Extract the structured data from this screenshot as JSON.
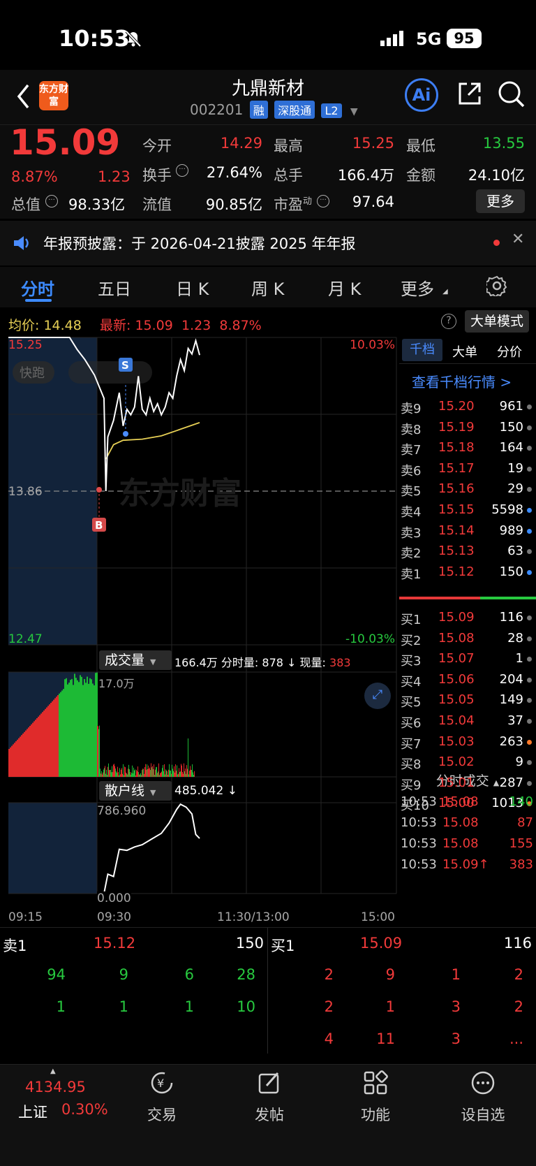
{
  "status_bar": {
    "time": "10:53",
    "network": "5G",
    "battery": "95"
  },
  "header": {
    "title": "九鼎新材",
    "code": "002201",
    "tags": [
      "融",
      "深股通",
      "L2"
    ],
    "logo_text": "东方财富",
    "ai_label": "Ai"
  },
  "quote": {
    "price": "15.09",
    "change_pct": "8.87%",
    "change": "1.23",
    "open_label": "今开",
    "open": "14.29",
    "high_label": "最高",
    "high": "15.25",
    "low_label": "最低",
    "low": "13.55",
    "turnover_label": "换手",
    "turnover": "27.64%",
    "volume_label": "总手",
    "volume": "166.4万",
    "amount_label": "金额",
    "amount": "24.10亿",
    "mktcap_label": "总值",
    "mktcap": "98.33亿",
    "float_label": "流值",
    "float": "90.85亿",
    "pe_label": "市盈",
    "pe_sup": "动",
    "pe": "97.64",
    "more_button": "更多"
  },
  "notice": {
    "text": "年报预披露：于 2026-04-21披露 2025 年年报"
  },
  "tabs": [
    "分时",
    "五日",
    "日 K",
    "周 K",
    "月 K",
    "更多"
  ],
  "active_tab": "分时",
  "chart_info": {
    "avg_label": "均价:",
    "avg": "14.48",
    "latest_label": "最新:",
    "latest": "15.09",
    "latest_change": "1.23",
    "latest_pct": "8.87%",
    "big_order_mode": "大单模式"
  },
  "chart_data": {
    "type": "line",
    "y_axis_left": {
      "top": "15.25",
      "mid": "13.86",
      "bottom": "12.47"
    },
    "y_axis_right": {
      "top": "10.03%",
      "bottom": "-10.03%"
    },
    "price_range": [
      12.47,
      15.25
    ],
    "x_ticks": [
      "09:15",
      "09:30",
      "11:30/13:00",
      "15:00"
    ],
    "watermark": "东方财富",
    "quickrun_label": "快跑",
    "markers": {
      "sell": "S",
      "buy": "B"
    },
    "price_series": [
      [
        0,
        15.25
      ],
      [
        0.32,
        15.25
      ],
      [
        0.36,
        15.14
      ],
      [
        0.4,
        15.05
      ],
      [
        0.45,
        14.91
      ],
      [
        0.5,
        14.7
      ],
      [
        0.51,
        13.86
      ],
      [
        0.52,
        14.35
      ],
      [
        0.55,
        14.5
      ],
      [
        0.58,
        14.75
      ],
      [
        0.6,
        14.45
      ],
      [
        0.62,
        14.6
      ],
      [
        0.64,
        14.55
      ],
      [
        0.66,
        14.62
      ],
      [
        0.68,
        14.9
      ],
      [
        0.7,
        14.6
      ],
      [
        0.72,
        14.55
      ],
      [
        0.74,
        14.7
      ],
      [
        0.76,
        14.58
      ],
      [
        0.78,
        14.65
      ],
      [
        0.8,
        14.55
      ],
      [
        0.82,
        14.62
      ],
      [
        0.84,
        14.75
      ],
      [
        0.86,
        14.7
      ],
      [
        0.88,
        14.9
      ],
      [
        0.9,
        15.05
      ],
      [
        0.92,
        14.95
      ],
      [
        0.94,
        15.15
      ],
      [
        0.96,
        15.1
      ],
      [
        0.98,
        15.22
      ],
      [
        1.0,
        15.09
      ]
    ],
    "avg_series": [
      [
        0.51,
        14.15
      ],
      [
        0.55,
        14.28
      ],
      [
        0.6,
        14.32
      ],
      [
        0.7,
        14.33
      ],
      [
        0.8,
        14.36
      ],
      [
        0.9,
        14.42
      ],
      [
        1.0,
        14.48
      ]
    ],
    "volume_panel": {
      "label": "成交量",
      "total": "166.4万",
      "period_label": "分时量:",
      "period": "878",
      "current_label": "现量:",
      "current": "383",
      "max": "17.0万"
    },
    "retail_panel": {
      "label": "散户线",
      "value": "485.042",
      "max": "786.960",
      "min": "0.000",
      "series": [
        [
          0.5,
          0.0
        ],
        [
          0.52,
          170
        ],
        [
          0.55,
          150
        ],
        [
          0.58,
          390
        ],
        [
          0.62,
          380
        ],
        [
          0.66,
          410
        ],
        [
          0.7,
          430
        ],
        [
          0.75,
          480
        ],
        [
          0.8,
          530
        ],
        [
          0.84,
          620
        ],
        [
          0.88,
          740
        ],
        [
          0.9,
          786
        ],
        [
          0.93,
          760
        ],
        [
          0.96,
          700
        ],
        [
          0.98,
          520
        ],
        [
          1.0,
          485
        ]
      ]
    }
  },
  "orderbook": {
    "tabs": [
      "千档",
      "大单",
      "分价"
    ],
    "link": "查看千档行情 >",
    "asks": [
      {
        "label": "卖9",
        "price": "15.20",
        "vol": "961",
        "dot": "#777"
      },
      {
        "label": "卖8",
        "price": "15.19",
        "vol": "150",
        "dot": "#777"
      },
      {
        "label": "卖7",
        "price": "15.18",
        "vol": "164",
        "dot": "#777"
      },
      {
        "label": "卖6",
        "price": "15.17",
        "vol": "19",
        "dot": "#777"
      },
      {
        "label": "卖5",
        "price": "15.16",
        "vol": "29",
        "dot": "#777"
      },
      {
        "label": "卖4",
        "price": "15.15",
        "vol": "5598",
        "dot": "#3c8cff"
      },
      {
        "label": "卖3",
        "price": "15.14",
        "vol": "989",
        "dot": "#3c8cff"
      },
      {
        "label": "卖2",
        "price": "15.13",
        "vol": "63",
        "dot": "#777"
      },
      {
        "label": "卖1",
        "price": "15.12",
        "vol": "150",
        "dot": "#3c8cff"
      }
    ],
    "bids": [
      {
        "label": "买1",
        "price": "15.09",
        "vol": "116",
        "dot": "#777"
      },
      {
        "label": "买2",
        "price": "15.08",
        "vol": "28",
        "dot": "#777"
      },
      {
        "label": "买3",
        "price": "15.07",
        "vol": "1",
        "dot": "#777"
      },
      {
        "label": "买4",
        "price": "15.06",
        "vol": "204",
        "dot": "#777"
      },
      {
        "label": "买5",
        "price": "15.05",
        "vol": "149",
        "dot": "#777"
      },
      {
        "label": "买6",
        "price": "15.04",
        "vol": "37",
        "dot": "#777"
      },
      {
        "label": "买7",
        "price": "15.03",
        "vol": "263",
        "dot": "#ff7a2a"
      },
      {
        "label": "买8",
        "price": "15.02",
        "vol": "9",
        "dot": "#777"
      },
      {
        "label": "买9",
        "price": "15.01",
        "vol": "287",
        "dot": "#777"
      },
      {
        "label": "买10",
        "price": "15.00",
        "vol": "1013",
        "dot": "#ff7a2a"
      }
    ],
    "trades_header": "分时成交",
    "trades": [
      {
        "time": "10:53",
        "price": "15.08",
        "vol": "140",
        "dir": "green"
      },
      {
        "time": "10:53",
        "price": "15.08",
        "vol": "87",
        "dir": "red"
      },
      {
        "time": "10:53",
        "price": "15.08",
        "vol": "155",
        "dir": "red"
      },
      {
        "time": "10:53",
        "price": "15.09↑",
        "vol": "383",
        "dir": "red"
      }
    ]
  },
  "queue": {
    "sell": {
      "label": "卖1",
      "price": "15.12",
      "vol": "150",
      "rows": [
        [
          "94",
          "9",
          "6",
          "28"
        ],
        [
          "1",
          "1",
          "1",
          "10"
        ]
      ]
    },
    "buy": {
      "label": "买1",
      "price": "15.09",
      "vol": "116",
      "rows": [
        [
          "2",
          "9",
          "1",
          "2"
        ],
        [
          "2",
          "1",
          "3",
          "2"
        ],
        [
          "4",
          "11",
          "3",
          "..."
        ]
      ]
    }
  },
  "toolbar": {
    "index_value": "4134.95",
    "index_name": "上证",
    "index_pct": "0.30%",
    "items": [
      {
        "label": "交易",
        "icon": "trade-icon"
      },
      {
        "label": "发帖",
        "icon": "post-icon"
      },
      {
        "label": "功能",
        "icon": "apps-icon"
      },
      {
        "label": "设自选",
        "icon": "more-icon"
      }
    ]
  },
  "colors": {
    "up": "#f23a3a",
    "down": "#27c93f",
    "accent": "#2f6fd6",
    "avg_line": "#e6cf55"
  }
}
